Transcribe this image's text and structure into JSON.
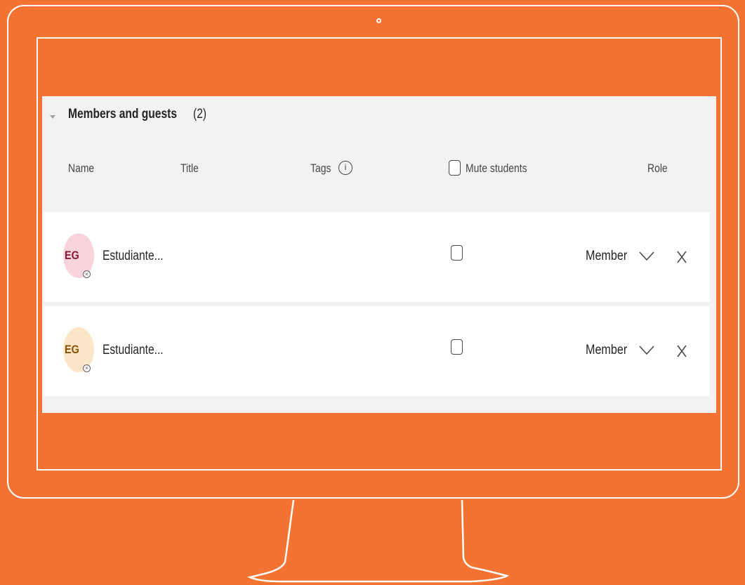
{
  "section": {
    "title": "Members and guests",
    "count": "(2)"
  },
  "columns": {
    "name": "Name",
    "title": "Title",
    "tags": "Tags",
    "mute": "Mute students",
    "role": "Role"
  },
  "info_icon_glyph": "i",
  "members": [
    {
      "initials": "EG",
      "name": "Estudiante...",
      "role": "Member",
      "avatar_bg": "#f8d4dc",
      "avatar_fg": "#8a1c3b",
      "status_glyph": "×"
    },
    {
      "initials": "EG",
      "name": "Estudiante...",
      "role": "Member",
      "avatar_bg": "#fbe6c8",
      "avatar_fg": "#8a5100",
      "status_glyph": "×"
    }
  ],
  "colors": {
    "background": "#f47332",
    "panel": "#f3f2f1",
    "row": "#ffffff"
  },
  "icons": [
    "collapse-caret-icon",
    "info-icon",
    "chevron-down-icon",
    "remove-icon",
    "presence-offline-icon"
  ]
}
